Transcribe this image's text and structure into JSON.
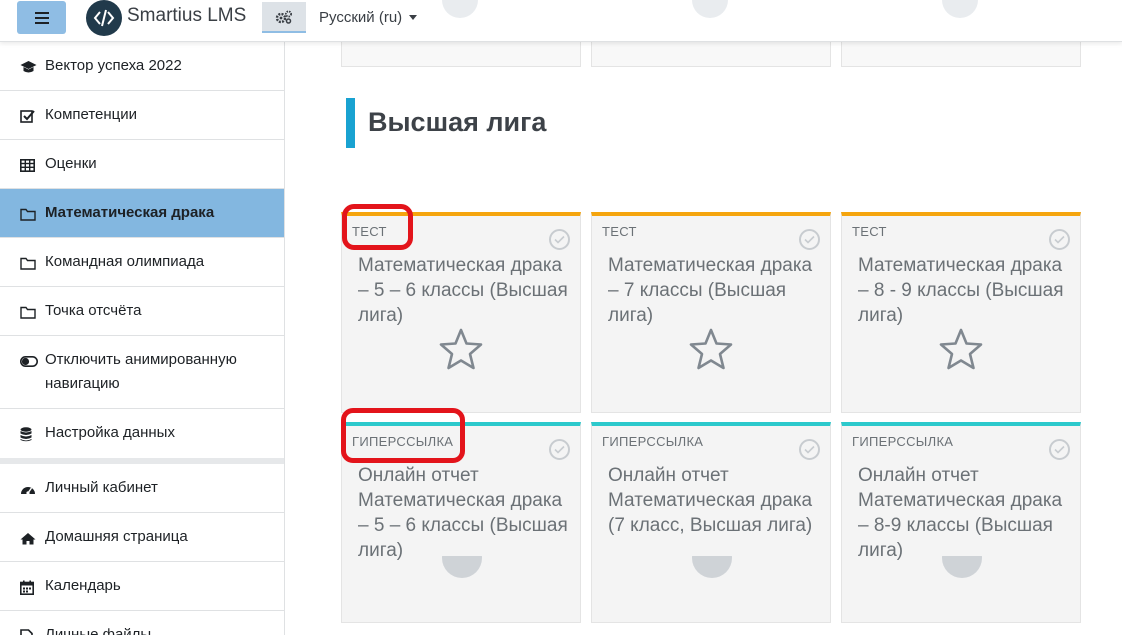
{
  "navbar": {
    "brand": "Smartius LMS",
    "language": "Русский (ru)",
    "icons": {
      "menu": "hamburger-icon",
      "logo": "code-logo-icon",
      "settings": "gears-icon"
    },
    "colors": {
      "menu_button": "#8fbde4",
      "logo_bg": "#213a4b"
    }
  },
  "sidebar": {
    "active_color": "#83b7e0",
    "items": [
      {
        "label": "Вектор успеха 2022",
        "icon": "graduation-cap-icon"
      },
      {
        "label": "Компетенции",
        "icon": "checkbox-icon"
      },
      {
        "label": "Оценки",
        "icon": "table-icon"
      },
      {
        "label": "Математическая драка",
        "icon": "folder-icon",
        "active": true
      },
      {
        "label": "Командная олимпиада",
        "icon": "folder-icon"
      },
      {
        "label": "Точка отсчёта",
        "icon": "folder-icon"
      },
      {
        "label": "Отключить анимированную навигацию",
        "icon": "toggle-icon"
      },
      {
        "label": "Настройка данных",
        "icon": "database-icon"
      },
      {
        "label": "Личный кабинет",
        "icon": "dashboard-icon"
      },
      {
        "label": "Домашняя страница",
        "icon": "home-icon"
      },
      {
        "label": "Календарь",
        "icon": "calendar-icon"
      },
      {
        "label": "Личные файлы",
        "icon": "file-icon"
      }
    ]
  },
  "section": {
    "title": "Высшая лига",
    "accent": "#19a2d1"
  },
  "cards": [
    {
      "type": "ТЕСТ",
      "title": "Математическая драка – 5 – 6 классы (Высшая лига)",
      "icon": "star-icon",
      "accent": "#f5a50e"
    },
    {
      "type": "ТЕСТ",
      "title": "Математическая драка – 7 классы (Высшая лига)",
      "icon": "star-icon",
      "accent": "#f5a50e"
    },
    {
      "type": "ТЕСТ",
      "title": "Математическая драка – 8 - 9 классы (Высшая лига)",
      "icon": "star-icon",
      "accent": "#f5a50e"
    },
    {
      "type": "ГИПЕРССЫЛКА",
      "title": "Онлайн отчет Математическая драка – 5 – 6 классы (Высшая лига)",
      "icon": "globe-icon",
      "accent": "#2cc9cc"
    },
    {
      "type": "ГИПЕРССЫЛКА",
      "title": "Онлайн отчет Математическая драка (7 класс, Высшая лига)",
      "icon": "globe-icon",
      "accent": "#2cc9cc"
    },
    {
      "type": "ГИПЕРССЫЛКА",
      "title": "Онлайн отчет Математическая драка – 8-9 классы (Высшая лига)",
      "icon": "globe-icon",
      "accent": "#2cc9cc"
    }
  ],
  "annotation_color": "#e3141b"
}
